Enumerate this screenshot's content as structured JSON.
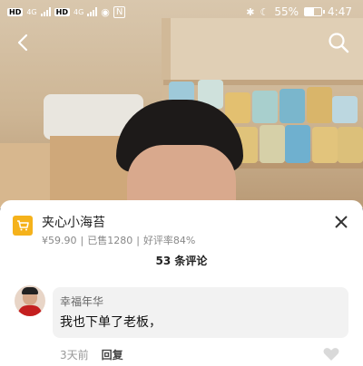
{
  "status_bar": {
    "network_badges": [
      "HD",
      "HD"
    ],
    "network_types": [
      "4G",
      "4G"
    ],
    "battery_percent": "55%",
    "time": "4:47"
  },
  "icons": {
    "back": "back-arrow-icon",
    "search": "search-icon",
    "cart": "cart-icon",
    "close": "close-icon",
    "like": "heart-icon"
  },
  "product": {
    "name": "夹心小海苔",
    "price": "¥59.90",
    "sold": "已售1280",
    "rating": "好评率84%"
  },
  "comments_header": {
    "title": "53 条评论"
  },
  "comments": [
    {
      "username": "幸福年华",
      "text": "我也下单了老板，",
      "time": "3天前",
      "reply_label": "回复"
    }
  ],
  "colors": {
    "accent": "#f5b21b",
    "sheet_background": "#ffffff",
    "bubble_background": "#f2f2f2"
  }
}
